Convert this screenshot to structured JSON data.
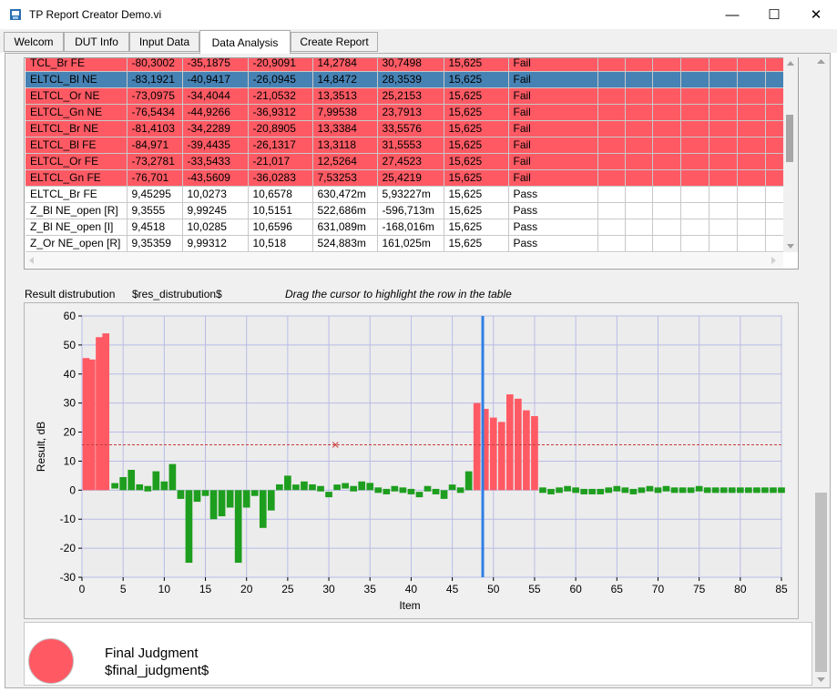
{
  "window": {
    "title": "TP Report Creator Demo.vi",
    "minimize_glyph": "—",
    "maximize_glyph": "☐",
    "close_glyph": "✕"
  },
  "tabs": [
    {
      "label": "Welcom"
    },
    {
      "label": "DUT Info"
    },
    {
      "label": "Input Data"
    },
    {
      "label": "Data Analysis"
    },
    {
      "label": "Create Report"
    }
  ],
  "table": {
    "rows": [
      {
        "status_color": "fail",
        "cells": [
          "TCL_Br FE",
          "-80,3002",
          "-35,1875",
          "-20,9091",
          "14,2784",
          "30,7498",
          "15,625",
          "Fail"
        ]
      },
      {
        "status_color": "selected",
        "cells": [
          "ELTCL_Bl NE",
          "-83,1921",
          "-40,9417",
          "-26,0945",
          "14,8472",
          "28,3539",
          "15,625",
          "Fail"
        ]
      },
      {
        "status_color": "fail",
        "cells": [
          "ELTCL_Or NE",
          "-73,0975",
          "-34,4044",
          "-21,0532",
          "13,3513",
          "25,2153",
          "15,625",
          "Fail"
        ]
      },
      {
        "status_color": "fail",
        "cells": [
          "ELTCL_Gn NE",
          "-76,5434",
          "-44,9266",
          "-36,9312",
          "7,99538",
          "23,7913",
          "15,625",
          "Fail"
        ]
      },
      {
        "status_color": "fail",
        "cells": [
          "ELTCL_Br NE",
          "-81,4103",
          "-34,2289",
          "-20,8905",
          "13,3384",
          "33,5576",
          "15,625",
          "Fail"
        ]
      },
      {
        "status_color": "fail",
        "cells": [
          "ELTCL_Bl FE",
          "-84,971",
          "-39,4435",
          "-26,1317",
          "13,3118",
          "31,5553",
          "15,625",
          "Fail"
        ]
      },
      {
        "status_color": "fail",
        "cells": [
          "ELTCL_Or FE",
          "-73,2781",
          "-33,5433",
          "-21,017",
          "12,5264",
          "27,4523",
          "15,625",
          "Fail"
        ]
      },
      {
        "status_color": "fail",
        "cells": [
          "ELTCL_Gn FE",
          "-76,701",
          "-43,5609",
          "-36,0283",
          "7,53253",
          "25,4219",
          "15,625",
          "Fail"
        ]
      },
      {
        "status_color": "pass",
        "cells": [
          "ELTCL_Br FE",
          "9,45295",
          "10,0273",
          "10,6578",
          "630,472m",
          "5,93227m",
          "15,625",
          "Pass"
        ]
      },
      {
        "status_color": "pass",
        "cells": [
          "Z_Bl NE_open [R]",
          "9,3555",
          "9,99245",
          "10,5151",
          "522,686m",
          "-596,713m",
          "15,625",
          "Pass"
        ]
      },
      {
        "status_color": "pass",
        "cells": [
          "Z_Bl NE_open [I]",
          "9,4518",
          "10,0285",
          "10,6596",
          "631,089m",
          "-168,016m",
          "15,625",
          "Pass"
        ]
      },
      {
        "status_color": "pass",
        "cells": [
          "Z_Or NE_open [R]",
          "9,35359",
          "9,99312",
          "10,518",
          "524,883m",
          "161,025m",
          "15,625",
          "Pass"
        ]
      }
    ]
  },
  "labels": {
    "result_distribution": "Result distrubution",
    "result_distribution_token": "$res_distrubution$",
    "hint": "Drag the cursor to highlight the row in the table",
    "final_judgment": "Final Judgment",
    "final_judgment_token": "$final_judgment$"
  },
  "colors": {
    "fail": "#ff5a64",
    "pass": "#1e9e1e",
    "cursor": "#2f7fe6",
    "limit": "#c83c3c",
    "led": "#ff5a64"
  },
  "chart_data": {
    "type": "bar",
    "xlabel": "Item",
    "ylabel": "Result, dB",
    "xlim": [
      0,
      85
    ],
    "ylim": [
      -30,
      60
    ],
    "xticks": [
      0,
      5,
      10,
      15,
      20,
      25,
      30,
      35,
      40,
      45,
      50,
      55,
      60,
      65,
      70,
      75,
      80,
      85
    ],
    "yticks": [
      -30,
      -20,
      -10,
      0,
      10,
      20,
      30,
      40,
      50,
      60
    ],
    "grid": true,
    "limit_line": 15.625,
    "cursor_x": 48.7,
    "items": [
      {
        "x": 0.5,
        "y": 45.5,
        "status": "fail"
      },
      {
        "x": 1.2,
        "y": 45,
        "status": "fail"
      },
      {
        "x": 2.1,
        "y": 52.7,
        "status": "fail"
      },
      {
        "x": 2.9,
        "y": 54,
        "status": "fail"
      },
      {
        "x": 4,
        "y": 1.5,
        "status": "pass"
      },
      {
        "x": 5,
        "y": 4.5,
        "status": "pass"
      },
      {
        "x": 6,
        "y": 7,
        "status": "pass"
      },
      {
        "x": 7,
        "y": 2,
        "status": "pass"
      },
      {
        "x": 8,
        "y": 0.5,
        "status": "pass"
      },
      {
        "x": 9,
        "y": 6.5,
        "status": "pass"
      },
      {
        "x": 10,
        "y": 3,
        "status": "pass"
      },
      {
        "x": 11,
        "y": 9,
        "status": "pass"
      },
      {
        "x": 12,
        "y": -3,
        "status": "pass"
      },
      {
        "x": 13,
        "y": -25,
        "status": "pass"
      },
      {
        "x": 14,
        "y": -4,
        "status": "pass"
      },
      {
        "x": 15,
        "y": -2,
        "status": "pass"
      },
      {
        "x": 16,
        "y": -10,
        "status": "pass"
      },
      {
        "x": 17,
        "y": -9,
        "status": "pass"
      },
      {
        "x": 18,
        "y": -6,
        "status": "pass"
      },
      {
        "x": 19,
        "y": -25,
        "status": "pass"
      },
      {
        "x": 20,
        "y": -6,
        "status": "pass"
      },
      {
        "x": 21,
        "y": -2,
        "status": "pass"
      },
      {
        "x": 22,
        "y": -13,
        "status": "pass"
      },
      {
        "x": 23,
        "y": -7,
        "status": "pass"
      },
      {
        "x": 24,
        "y": 2,
        "status": "pass"
      },
      {
        "x": 25,
        "y": 5,
        "status": "pass"
      },
      {
        "x": 26,
        "y": 1,
        "status": "pass"
      },
      {
        "x": 27,
        "y": 3,
        "status": "pass"
      },
      {
        "x": 28,
        "y": 2,
        "status": "pass"
      },
      {
        "x": 29,
        "y": 0.5,
        "status": "pass"
      },
      {
        "x": 30,
        "y": -1.5,
        "status": "pass"
      },
      {
        "x": 31,
        "y": 1,
        "status": "pass"
      },
      {
        "x": 32,
        "y": 1.5,
        "status": "pass"
      },
      {
        "x": 33,
        "y": 0.5,
        "status": "pass"
      },
      {
        "x": 34,
        "y": 3,
        "status": "pass"
      },
      {
        "x": 35,
        "y": 2.5,
        "status": "pass"
      },
      {
        "x": 36,
        "y": 0,
        "status": "pass"
      },
      {
        "x": 37,
        "y": -0.5,
        "status": "pass"
      },
      {
        "x": 38,
        "y": 0.5,
        "status": "pass"
      },
      {
        "x": 39,
        "y": 0,
        "status": "pass"
      },
      {
        "x": 40,
        "y": -0.5,
        "status": "pass"
      },
      {
        "x": 41,
        "y": -1.5,
        "status": "pass"
      },
      {
        "x": 42,
        "y": 0.5,
        "status": "pass"
      },
      {
        "x": 43,
        "y": -0.5,
        "status": "pass"
      },
      {
        "x": 44,
        "y": -3,
        "status": "pass"
      },
      {
        "x": 45,
        "y": 1,
        "status": "pass"
      },
      {
        "x": 46,
        "y": 0,
        "status": "pass"
      },
      {
        "x": 47,
        "y": 6.5,
        "status": "pass"
      },
      {
        "x": 48,
        "y": 30,
        "status": "fail"
      },
      {
        "x": 49,
        "y": 28,
        "status": "fail"
      },
      {
        "x": 50,
        "y": 25,
        "status": "fail"
      },
      {
        "x": 51,
        "y": 23.5,
        "status": "fail"
      },
      {
        "x": 52,
        "y": 33,
        "status": "fail"
      },
      {
        "x": 53,
        "y": 31.5,
        "status": "fail"
      },
      {
        "x": 54,
        "y": 27.5,
        "status": "fail"
      },
      {
        "x": 55,
        "y": 25.5,
        "status": "fail"
      },
      {
        "x": 56,
        "y": 0,
        "status": "pass"
      },
      {
        "x": 57,
        "y": -0.5,
        "status": "pass"
      },
      {
        "x": 58,
        "y": 0,
        "status": "pass"
      },
      {
        "x": 59,
        "y": 0.5,
        "status": "pass"
      },
      {
        "x": 60,
        "y": 0,
        "status": "pass"
      },
      {
        "x": 61,
        "y": -0.5,
        "status": "pass"
      },
      {
        "x": 62,
        "y": -0.5,
        "status": "pass"
      },
      {
        "x": 63,
        "y": -0.5,
        "status": "pass"
      },
      {
        "x": 64,
        "y": 0,
        "status": "pass"
      },
      {
        "x": 65,
        "y": 0.5,
        "status": "pass"
      },
      {
        "x": 66,
        "y": 0,
        "status": "pass"
      },
      {
        "x": 67,
        "y": -0.5,
        "status": "pass"
      },
      {
        "x": 68,
        "y": 0,
        "status": "pass"
      },
      {
        "x": 69,
        "y": 0.5,
        "status": "pass"
      },
      {
        "x": 70,
        "y": 0,
        "status": "pass"
      },
      {
        "x": 71,
        "y": 0.5,
        "status": "pass"
      },
      {
        "x": 72,
        "y": 0,
        "status": "pass"
      },
      {
        "x": 73,
        "y": 0,
        "status": "pass"
      },
      {
        "x": 74,
        "y": 0,
        "status": "pass"
      },
      {
        "x": 75,
        "y": 0.5,
        "status": "pass"
      },
      {
        "x": 76,
        "y": 0,
        "status": "pass"
      },
      {
        "x": 77,
        "y": 0,
        "status": "pass"
      },
      {
        "x": 78,
        "y": 0,
        "status": "pass"
      },
      {
        "x": 79,
        "y": 0,
        "status": "pass"
      },
      {
        "x": 80,
        "y": 0,
        "status": "pass"
      },
      {
        "x": 81,
        "y": 0,
        "status": "pass"
      },
      {
        "x": 82,
        "y": 0,
        "status": "pass"
      },
      {
        "x": 83,
        "y": 0,
        "status": "pass"
      },
      {
        "x": 84,
        "y": 0,
        "status": "pass"
      },
      {
        "x": 85,
        "y": 0,
        "status": "pass"
      }
    ]
  }
}
